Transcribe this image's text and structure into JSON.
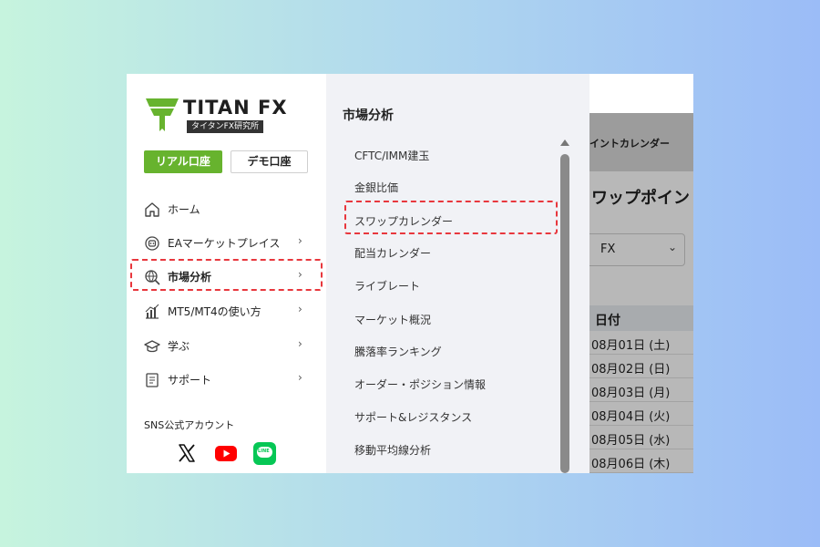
{
  "logo": {
    "brand": "TITAN FX",
    "subtitle": "タイタンFX研究所"
  },
  "account_buttons": {
    "real": "リアル口座",
    "demo": "デモ口座"
  },
  "nav": [
    {
      "label": "ホーム",
      "icon": "home-icon"
    },
    {
      "label": "EAマーケットプレイス",
      "icon": "ea-robot-icon"
    },
    {
      "label": "市場分析",
      "icon": "globe-search-icon"
    },
    {
      "label": "MT5/MT4の使い方",
      "icon": "chart-bars-icon"
    },
    {
      "label": "学ぶ",
      "icon": "graduation-cap-icon"
    },
    {
      "label": "サポート",
      "icon": "document-icon"
    }
  ],
  "chevron": "›",
  "sns": {
    "label": "SNS公式アカウント",
    "icons": [
      "x-icon",
      "youtube-icon",
      "line-icon"
    ],
    "line_text": "LINE"
  },
  "submenu": {
    "title": "市場分析",
    "items": [
      "CFTC/IMM建玉",
      "金銀比価",
      "スワップカレンダー",
      "配当カレンダー",
      "ライブレート",
      "マーケット概況",
      "騰落率ランキング",
      "オーダー・ポジション情報",
      "サポート&レジスタンス",
      "移動平均線分析"
    ]
  },
  "background_page": {
    "breadcrumb": "イントカレンダー",
    "title": "ワップポイント",
    "select_value": "FX",
    "select_chevron": "⌄",
    "table_header": "日付",
    "rows": [
      "08月01日 (土)",
      "08月02日 (日)",
      "08月03日 (月)",
      "08月04日 (火)",
      "08月05日 (水)",
      "08月06日 (木)"
    ]
  },
  "colors": {
    "accent_green": "#67b32e",
    "highlight_red": "#e8373d",
    "youtube_red": "#ff0000",
    "line_green": "#06c755"
  }
}
